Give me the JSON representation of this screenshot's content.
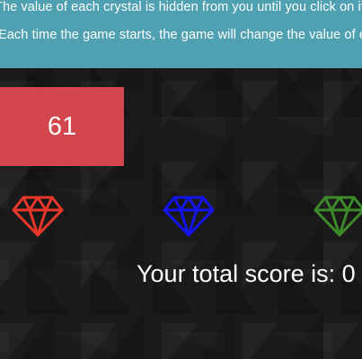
{
  "instructions": {
    "line1": "The value of each crystal is hidden from you until you click on it.",
    "line2": "Each time the game starts, the game will change the value of each crystal."
  },
  "target_number": "61",
  "crystals": [
    {
      "name": "red-crystal",
      "icon": "diamond-icon",
      "color": "#e8372a"
    },
    {
      "name": "blue-crystal",
      "icon": "diamond-icon",
      "color": "#1414ef"
    },
    {
      "name": "green-crystal",
      "icon": "diamond-icon",
      "color": "#3c8a2a"
    }
  ],
  "score": {
    "label": "Your total score is: ",
    "value": "0"
  }
}
